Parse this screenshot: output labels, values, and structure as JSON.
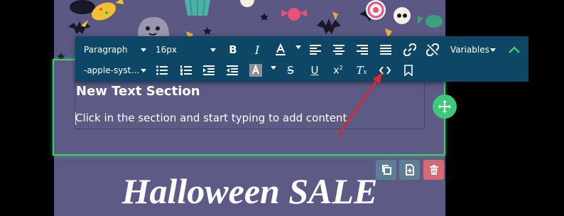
{
  "toolbar": {
    "format_select": "Paragraph",
    "size_select": "16px",
    "font_select": "-apple-syst…",
    "variables_label": "Variables",
    "superscript_mark": "2"
  },
  "section": {
    "heading": "New Text Section",
    "body": "Click in the section and start typing to add content."
  },
  "page": {
    "title": "Halloween SALE"
  },
  "colors": {
    "selection_border": "#3ecf6e",
    "toolbar_bg": "#0e4766",
    "move_button": "#3ec879",
    "delete_button": "#d46a72",
    "action_button": "#5c7f93",
    "canvas_bg": "#5d5a86",
    "annotation_arrow": "#e0262b"
  },
  "icons": [
    "bold-icon",
    "italic-icon",
    "text-color-icon",
    "align-left-icon",
    "align-center-icon",
    "align-right-icon",
    "align-justify-icon",
    "link-icon",
    "unlink-icon",
    "collapse-icon",
    "bullet-list-icon",
    "numbered-list-icon",
    "indent-icon",
    "outdent-icon",
    "highlight-icon",
    "strikethrough-icon",
    "underline-icon",
    "superscript-icon",
    "clear-format-icon",
    "source-code-icon",
    "bookmark-icon",
    "move-icon",
    "duplicate-icon",
    "save-block-icon",
    "delete-icon"
  ]
}
